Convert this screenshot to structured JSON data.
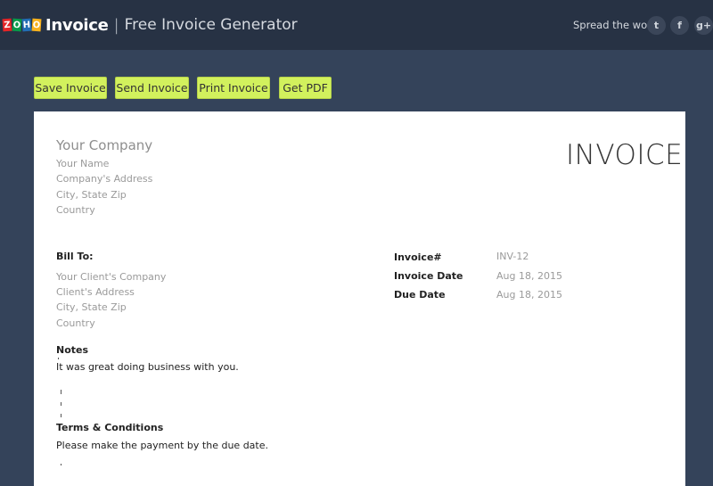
{
  "header": {
    "logo_letters": [
      "Z",
      "O",
      "H",
      "O"
    ],
    "brand": "Invoice",
    "separator": "|",
    "subtitle": "Free Invoice Generator",
    "spread_label": "Spread the word",
    "social": [
      {
        "name": "twitter",
        "glyph": "t"
      },
      {
        "name": "facebook",
        "glyph": "f"
      },
      {
        "name": "google-plus",
        "glyph": "g+"
      }
    ]
  },
  "toolbar": {
    "save_label": "Save Invoice",
    "send_label": "Send Invoice",
    "print_label": "Print Invoice",
    "pdf_label": "Get PDF"
  },
  "invoice": {
    "title": "INVOICE",
    "from": {
      "company": "Your Company",
      "name": "Your Name",
      "address": "Company's Address",
      "city": "City, State Zip",
      "country": "Country"
    },
    "bill_to": {
      "label": "Bill To:",
      "company": "Your Client's Company",
      "address": "Client's Address",
      "city": "City, State Zip",
      "country": "Country"
    },
    "meta": [
      {
        "label": "Invoice#",
        "value": "INV-12"
      },
      {
        "label": "Invoice Date",
        "value": "Aug 18, 2015"
      },
      {
        "label": "Due Date",
        "value": "Aug 18, 2015"
      }
    ],
    "notes": {
      "label": "Notes",
      "text": "It was great doing business with you."
    },
    "terms": {
      "label": "Terms & Conditions",
      "text": "Please make the payment by the due date."
    }
  }
}
